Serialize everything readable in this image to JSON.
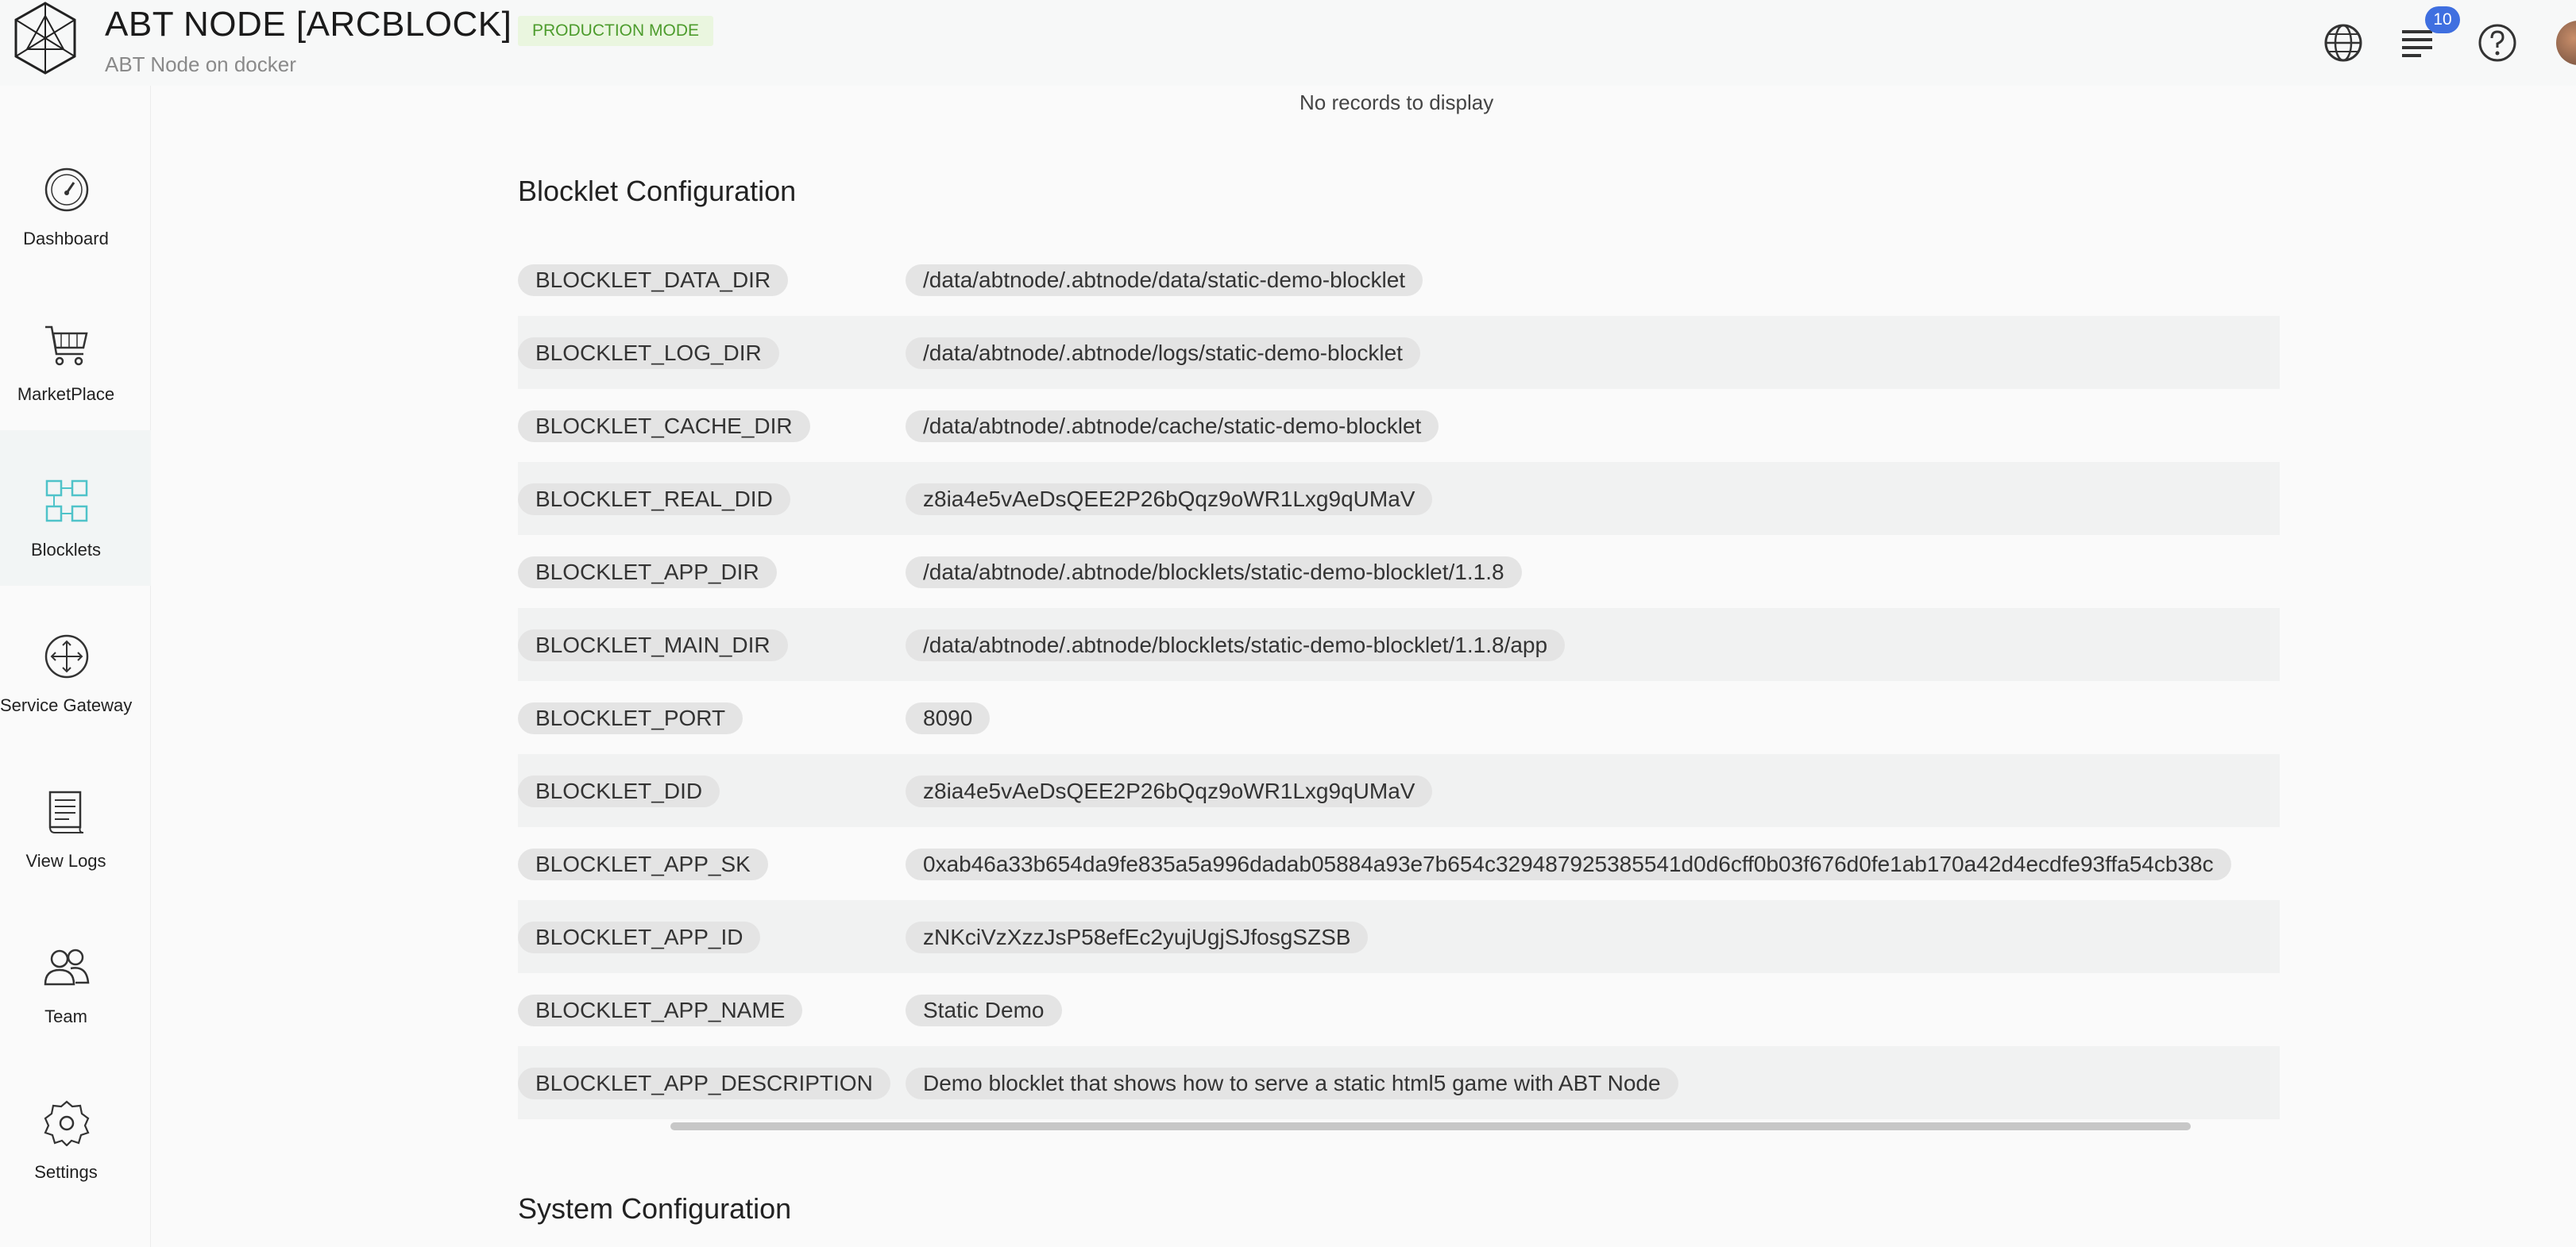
{
  "header": {
    "title": "ABT NODE [ARCBLOCK]",
    "mode_badge": "PRODUCTION MODE",
    "subtitle": "ABT Node on docker",
    "notification_count": "10",
    "icons": [
      "logo-icon",
      "globe-icon",
      "notifications-icon",
      "help-icon",
      "avatar"
    ]
  },
  "sidebar": {
    "items": [
      {
        "label": "Dashboard",
        "icon": "dashboard-icon"
      },
      {
        "label": "MarketPlace",
        "icon": "cart-icon"
      },
      {
        "label": "Blocklets",
        "icon": "blocklets-icon",
        "active": true
      },
      {
        "label": "Service Gateway",
        "icon": "gateway-icon"
      },
      {
        "label": "View Logs",
        "icon": "logs-icon"
      },
      {
        "label": "Team",
        "icon": "team-icon"
      },
      {
        "label": "Settings",
        "icon": "gear-icon"
      }
    ]
  },
  "main": {
    "no_records": "No records to display",
    "blocklet_config_title": "Blocklet Configuration",
    "system_config_title": "System Configuration",
    "config_rows": [
      {
        "key": "BLOCKLET_DATA_DIR",
        "value": "/data/abtnode/.abtnode/data/static-demo-blocklet"
      },
      {
        "key": "BLOCKLET_LOG_DIR",
        "value": "/data/abtnode/.abtnode/logs/static-demo-blocklet"
      },
      {
        "key": "BLOCKLET_CACHE_DIR",
        "value": "/data/abtnode/.abtnode/cache/static-demo-blocklet"
      },
      {
        "key": "BLOCKLET_REAL_DID",
        "value": "z8ia4e5vAeDsQEE2P26bQqz9oWR1Lxg9qUMaV"
      },
      {
        "key": "BLOCKLET_APP_DIR",
        "value": "/data/abtnode/.abtnode/blocklets/static-demo-blocklet/1.1.8"
      },
      {
        "key": "BLOCKLET_MAIN_DIR",
        "value": "/data/abtnode/.abtnode/blocklets/static-demo-blocklet/1.1.8/app"
      },
      {
        "key": "BLOCKLET_PORT",
        "value": "8090"
      },
      {
        "key": "BLOCKLET_DID",
        "value": "z8ia4e5vAeDsQEE2P26bQqz9oWR1Lxg9qUMaV"
      },
      {
        "key": "BLOCKLET_APP_SK",
        "value": "0xab46a33b654da9fe835a5a996dadab05884a93e7b654c329487925385541d0d6cff0b03f676d0fe1ab170a42d4ecdfe93ffa54cb38c"
      },
      {
        "key": "BLOCKLET_APP_ID",
        "value": "zNKciVzXzzJsP58efEc2yujUgjSJfosgSZSB"
      },
      {
        "key": "BLOCKLET_APP_NAME",
        "value": "Static Demo"
      },
      {
        "key": "BLOCKLET_APP_DESCRIPTION",
        "value": "Demo blocklet that shows how to serve a static html5 game with ABT Node"
      }
    ]
  },
  "colors": {
    "accent_blue": "#3f6fe0",
    "badge_green_text": "#4d9c2d",
    "badge_green_bg": "#eaf6df",
    "active_icon_teal": "#4fc3c9"
  }
}
